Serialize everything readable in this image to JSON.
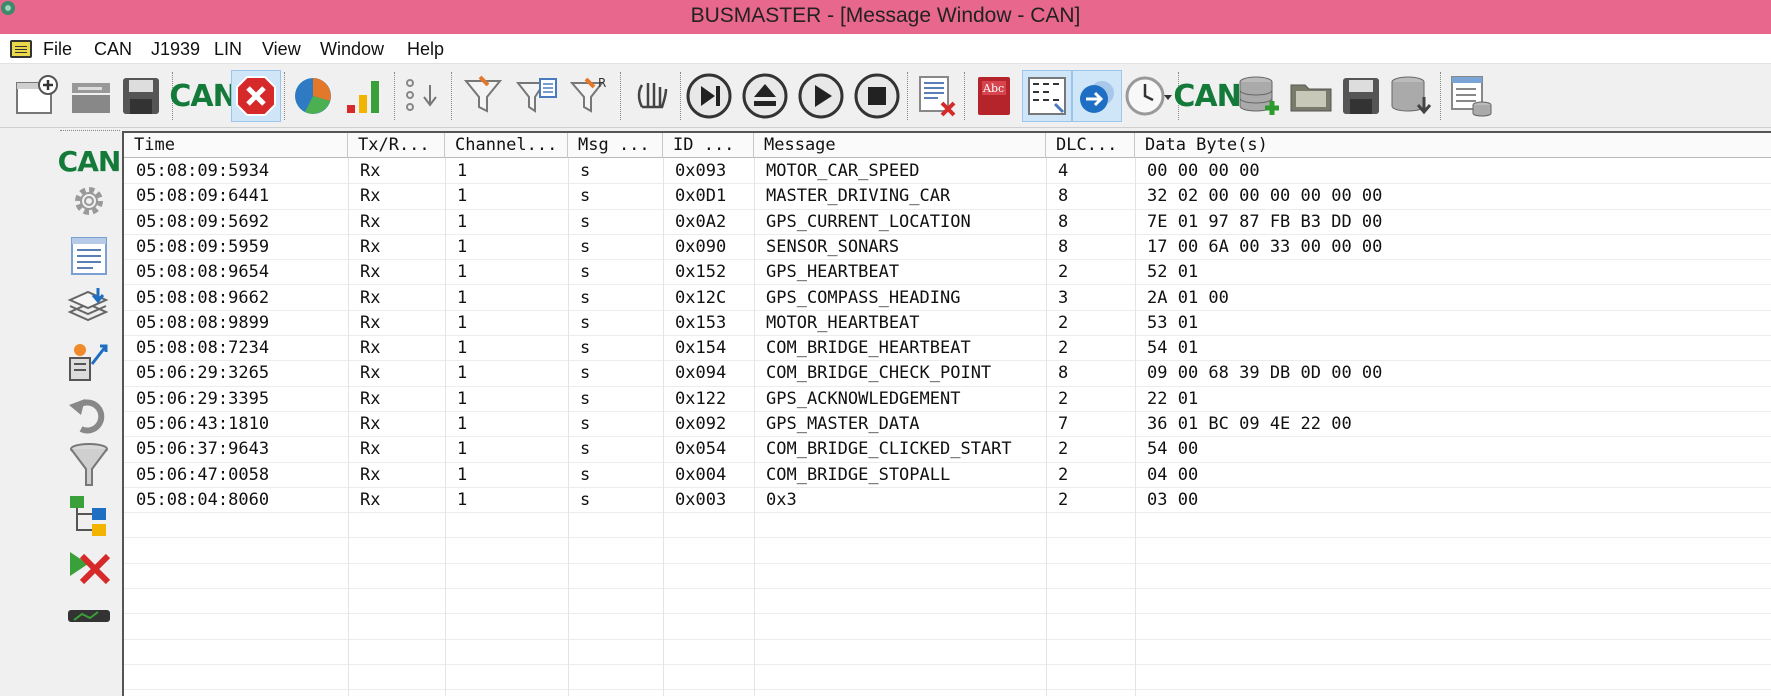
{
  "window": {
    "title": "BUSMASTER - [Message Window - CAN]"
  },
  "menu": [
    "File",
    "CAN",
    "J1939",
    "LIN",
    "View",
    "Window",
    "Help"
  ],
  "toolbar": {
    "can_label_1": "CAN",
    "can_label_2": "CAN",
    "abc_label": "Abc"
  },
  "sidebar": {
    "can_label": "CAN"
  },
  "table": {
    "columns": [
      "Time",
      "Tx/R...",
      "Channel...",
      "Msg ...",
      "ID  ...",
      "Message",
      "DLC...",
      "Data Byte(s)"
    ],
    "rows": [
      [
        "05:08:09:5934",
        "Rx",
        "1",
        "s",
        "0x093",
        "MOTOR_CAR_SPEED",
        "4",
        "00 00 00 00"
      ],
      [
        "05:08:09:6441",
        "Rx",
        "1",
        "s",
        "0x0D1",
        "MASTER_DRIVING_CAR",
        "8",
        "32 02 00 00 00 00 00 00"
      ],
      [
        "05:08:09:5692",
        "Rx",
        "1",
        "s",
        "0x0A2",
        "GPS_CURRENT_LOCATION",
        "8",
        "7E 01 97 87 FB B3 DD 00"
      ],
      [
        "05:08:09:5959",
        "Rx",
        "1",
        "s",
        "0x090",
        "SENSOR_SONARS",
        "8",
        "17 00 6A 00 33 00 00 00"
      ],
      [
        "05:08:08:9654",
        "Rx",
        "1",
        "s",
        "0x152",
        "GPS_HEARTBEAT",
        "2",
        "52 01"
      ],
      [
        "05:08:08:9662",
        "Rx",
        "1",
        "s",
        "0x12C",
        "GPS_COMPASS_HEADING",
        "3",
        "2A 01 00"
      ],
      [
        "05:08:08:9899",
        "Rx",
        "1",
        "s",
        "0x153",
        "MOTOR_HEARTBEAT",
        "2",
        "53 01"
      ],
      [
        "05:08:08:7234",
        "Rx",
        "1",
        "s",
        "0x154",
        "COM_BRIDGE_HEARTBEAT",
        "2",
        "54 01"
      ],
      [
        "05:06:29:3265",
        "Rx",
        "1",
        "s",
        "0x094",
        "COM_BRIDGE_CHECK_POINT",
        "8",
        "09 00 68 39 DB 0D 00 00"
      ],
      [
        "05:06:29:3395",
        "Rx",
        "1",
        "s",
        "0x122",
        "GPS_ACKNOWLEDGEMENT",
        "2",
        "22 01"
      ],
      [
        "05:06:43:1810",
        "Rx",
        "1",
        "s",
        "0x092",
        "GPS_MASTER_DATA",
        "7",
        "36 01 BC 09 4E 22 00"
      ],
      [
        "05:06:37:9643",
        "Rx",
        "1",
        "s",
        "0x054",
        "COM_BRIDGE_CLICKED_START",
        "2",
        "54 00"
      ],
      [
        "05:06:47:0058",
        "Rx",
        "1",
        "s",
        "0x004",
        "COM_BRIDGE_STOPALL",
        "2",
        "04 00"
      ],
      [
        "05:08:04:8060",
        "Rx",
        "1",
        "s",
        "0x003",
        "0x3",
        "2",
        "03 00"
      ]
    ]
  },
  "colors": {
    "titlebar": "#e8678d",
    "can_green": "#137a3a"
  }
}
